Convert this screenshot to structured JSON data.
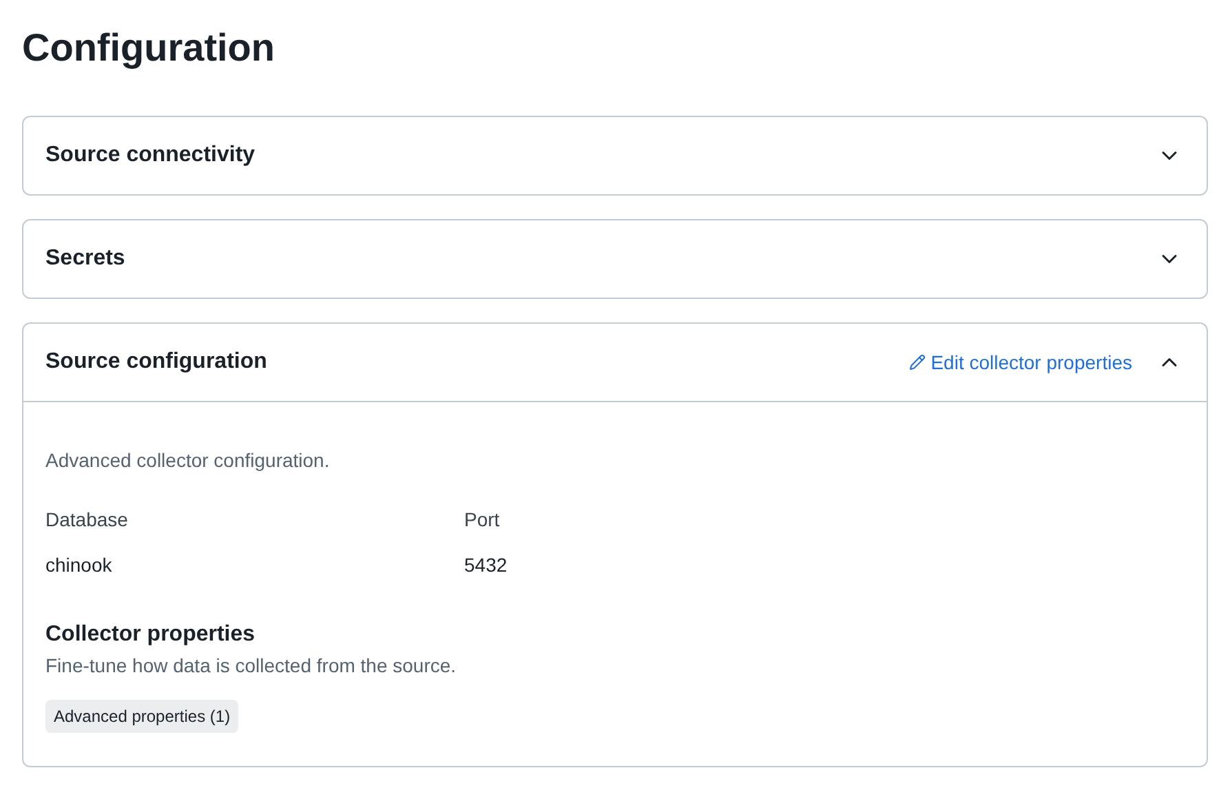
{
  "title": "Configuration",
  "sections": [
    {
      "title": "Source connectivity",
      "expanded": false
    },
    {
      "title": "Secrets",
      "expanded": false
    },
    {
      "title": "Source configuration",
      "expanded": true,
      "action": "Edit collector properties",
      "description": "Advanced collector configuration.",
      "fields": [
        {
          "label": "Database",
          "value": "chinook"
        },
        {
          "label": "Port",
          "value": "5432"
        }
      ],
      "subsection": {
        "title": "Collector properties",
        "description": "Fine-tune how data is collected from the source.",
        "tag": "Advanced properties (1)"
      }
    }
  ]
}
